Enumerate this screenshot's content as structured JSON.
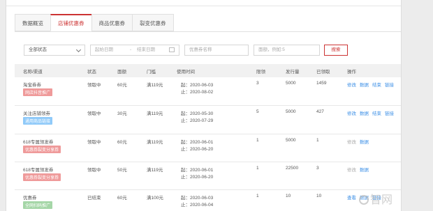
{
  "tabs": [
    "数据概览",
    "店铺优惠券",
    "商品优惠券",
    "裂变优惠券"
  ],
  "filters": {
    "status": "全部状态",
    "start_date": "起始日期",
    "sep": "-",
    "end_date": "结束日期",
    "coupon_name": "优惠券名称",
    "store": "面额，例如:5",
    "search": "搜索"
  },
  "columns": [
    "名称/渠道",
    "状态",
    "面额",
    "门槛",
    "使用时间",
    "限领",
    "发行量",
    "已领取",
    "操作"
  ],
  "rows": [
    {
      "name": "淘宝券券",
      "tag": "网店抖音推广",
      "tag_color": "#ef9a9a",
      "status": "领取中",
      "amount": "60元",
      "threshold": "满119元",
      "start": "起：2020-06-03",
      "end": "止：2020-08-02",
      "limit": "3",
      "issued": "5000",
      "received": "1459",
      "ops": [
        "修改",
        "数据",
        "结束",
        "链接"
      ]
    },
    {
      "name": "关注店铺领券",
      "tag": "通用商品链接",
      "tag_color": "#90caf9",
      "status": "领取中",
      "amount": "30元",
      "threshold": "满119元",
      "start": "起：2020-05-30",
      "end": "止：2020-07-29",
      "limit": "5",
      "issued": "5000",
      "received": "427",
      "ops": [
        "修改",
        "数据",
        "结束",
        "链接"
      ]
    },
    {
      "name": "618专属领发券",
      "tag": "优惠券裂变分享券",
      "tag_color": "#ef9a9a",
      "status": "领取中",
      "amount": "60元",
      "threshold": "满119元",
      "start": "起：2020-06-01",
      "end": "止：2020-06-20",
      "limit": "1",
      "issued": "5000",
      "received": "1",
      "ops": [
        "修改",
        "数据"
      ]
    },
    {
      "name": "618专属领发券",
      "tag": "优惠券裂变分享券",
      "tag_color": "#ef9a9a",
      "status": "领取中",
      "amount": "50元",
      "threshold": "满119元",
      "start": "起：2020-06-01",
      "end": "止：2020-06-20",
      "limit": "1",
      "issued": "22500",
      "received": "3",
      "ops": [
        "修改",
        "数据"
      ]
    },
    {
      "name": "优惠券",
      "tag": "全网扫码推广",
      "tag_color": "#a5d6a7",
      "status": "已结束",
      "amount": "60元",
      "threshold": "满100元",
      "start": "起：2020-06-03",
      "end": "止：2020-06-04",
      "limit": "1",
      "issued": "10",
      "received": "10",
      "ops": [
        "查看",
        "数据",
        "链接"
      ]
    }
  ],
  "watermark": "智网"
}
